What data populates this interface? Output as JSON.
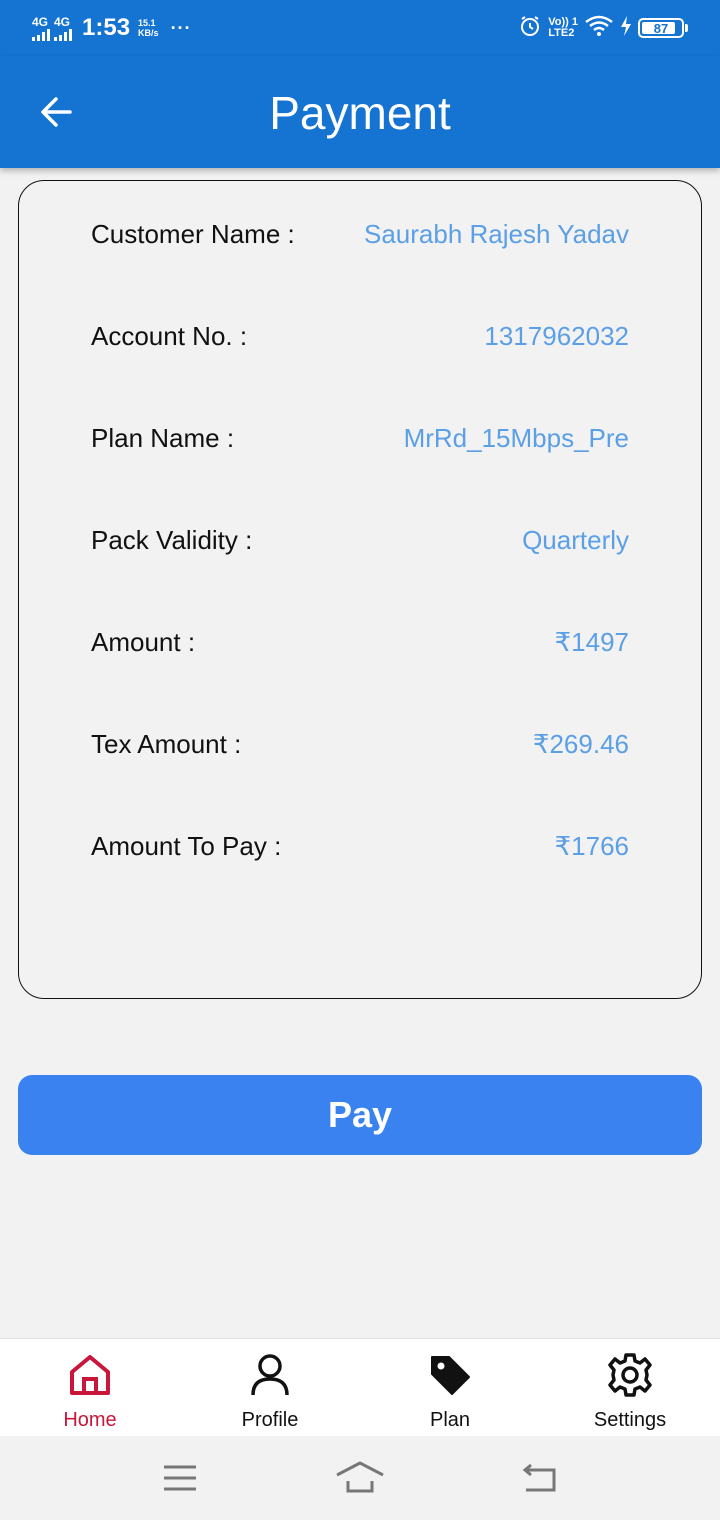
{
  "status_bar": {
    "network1": "4G",
    "network2": "4G",
    "time": "1:53",
    "speed_value": "15.1",
    "speed_unit": "KB/s",
    "more": "···",
    "volte": "Vo)) 1",
    "lte": "LTE2",
    "battery": "87",
    "battery_level": 0.87
  },
  "header": {
    "title": "Payment",
    "back_icon": "arrow-left-icon"
  },
  "details": {
    "rows": [
      {
        "label": "Customer Name :",
        "value": "Saurabh Rajesh Yadav"
      },
      {
        "label": "Account No. :",
        "value": "1317962032"
      },
      {
        "label": "Plan Name :",
        "value": "MrRd_15Mbps_Pre"
      },
      {
        "label": "Pack Validity :",
        "value": "Quarterly"
      },
      {
        "label": "Amount :",
        "value": "₹1497"
      },
      {
        "label": "Tex Amount :",
        "value": "₹269.46"
      },
      {
        "label": "Amount To Pay :",
        "value": "₹1766"
      }
    ]
  },
  "pay_button": {
    "label": "Pay"
  },
  "bottom_nav": {
    "items": [
      {
        "label": "Home",
        "icon": "home-icon",
        "active": true
      },
      {
        "label": "Profile",
        "icon": "person-icon",
        "active": false
      },
      {
        "label": "Plan",
        "icon": "tag-icon",
        "active": false
      },
      {
        "label": "Settings",
        "icon": "gear-icon",
        "active": false
      }
    ]
  },
  "system_nav": {
    "icons": [
      "menu-icon",
      "home-outline-icon",
      "back-return-icon"
    ]
  },
  "colors": {
    "primary": "#1573d2",
    "button": "#3b82f1",
    "value_text": "#5b9fe6",
    "active_nav": "#c8173a"
  }
}
